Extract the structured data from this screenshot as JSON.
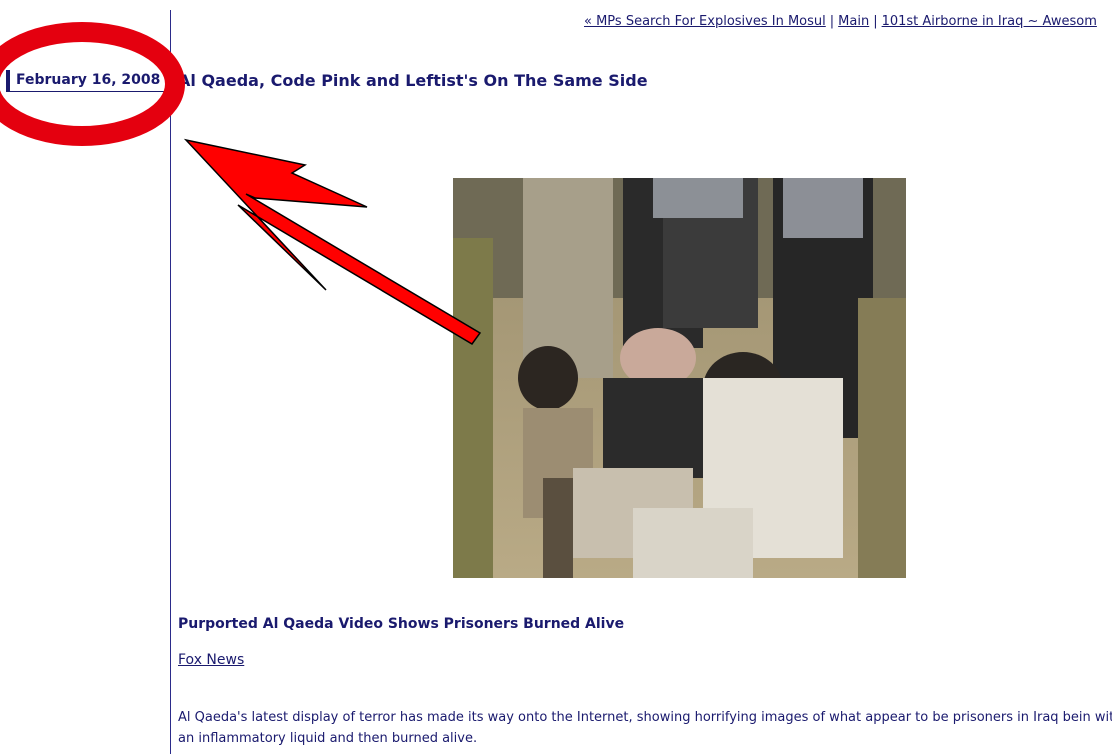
{
  "nav": {
    "prev_link": "« MPs Search For Explosives In Mosul",
    "main_link": "Main",
    "next_link": "101st Airborne in Iraq ~ Awesom",
    "separator": "|"
  },
  "post": {
    "date": "February 16, 2008",
    "title": "Al Qaeda, Code Pink and Leftist's On The Same Side",
    "subheading": "Purported Al Qaeda Video Shows Prisoners Burned Alive",
    "source": "Fox News",
    "body": "Al Qaeda's latest display of terror has made its way onto the Internet, showing horrifying images of what appear to be prisoners in Iraq bein with an inflammatory liquid and then burned alive."
  },
  "annotation": {
    "circle_color": "#e4000f",
    "arrow_color": "#ff0000"
  },
  "colors": {
    "text": "#1a1a6e",
    "rule": "#2b2b8a"
  }
}
